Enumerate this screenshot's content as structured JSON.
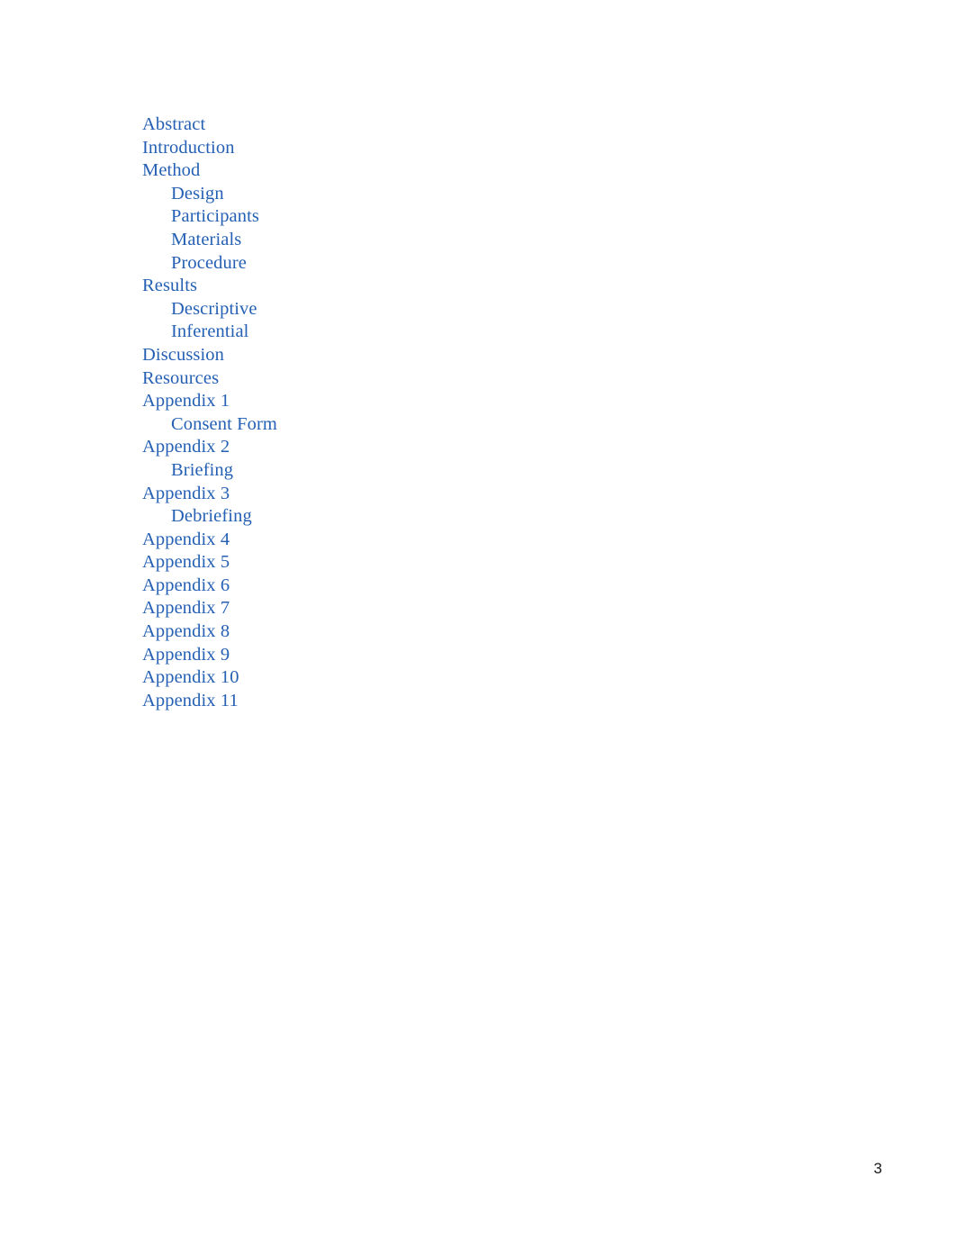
{
  "document": {
    "page_number": "3",
    "text_color": "#2560b4",
    "page_number_color": "#1a1a1a",
    "background_color": "#ffffff"
  },
  "toc": {
    "entries": [
      {
        "label": "Abstract",
        "level": 1
      },
      {
        "label": "Introduction",
        "level": 1
      },
      {
        "label": "Method",
        "level": 1
      },
      {
        "label": "Design",
        "level": 2
      },
      {
        "label": "Participants",
        "level": 2
      },
      {
        "label": "Materials",
        "level": 2
      },
      {
        "label": "Procedure",
        "level": 2
      },
      {
        "label": "Results",
        "level": 1
      },
      {
        "label": "Descriptive",
        "level": 2
      },
      {
        "label": "Inferential",
        "level": 2
      },
      {
        "label": "Discussion",
        "level": 1
      },
      {
        "label": "Resources",
        "level": 1
      },
      {
        "label": "Appendix 1",
        "level": 1
      },
      {
        "label": "Consent Form",
        "level": 2
      },
      {
        "label": "Appendix 2",
        "level": 1
      },
      {
        "label": "Briefing",
        "level": 2
      },
      {
        "label": "Appendix 3",
        "level": 1
      },
      {
        "label": "Debriefing",
        "level": 2
      },
      {
        "label": "Appendix 4",
        "level": 1
      },
      {
        "label": "Appendix 5",
        "level": 1
      },
      {
        "label": "Appendix 6",
        "level": 1
      },
      {
        "label": "Appendix 7",
        "level": 1
      },
      {
        "label": "Appendix 8",
        "level": 1
      },
      {
        "label": "Appendix 9",
        "level": 1
      },
      {
        "label": "Appendix 10",
        "level": 1
      },
      {
        "label": "Appendix 11",
        "level": 1
      }
    ]
  }
}
